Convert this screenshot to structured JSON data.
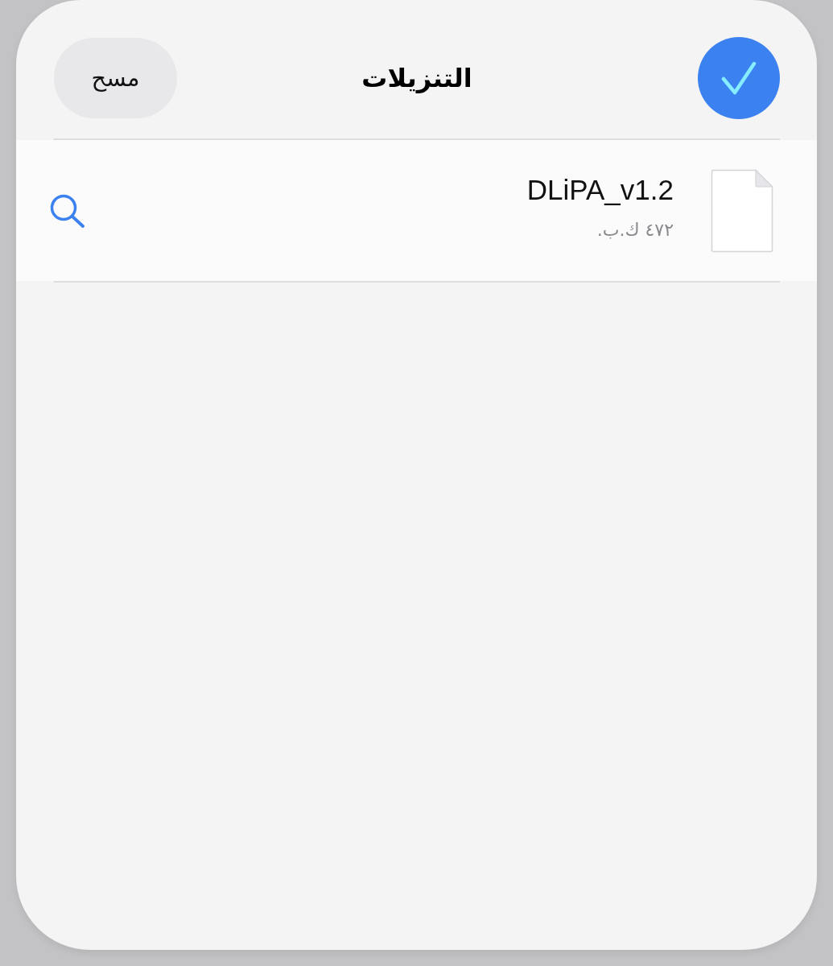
{
  "header": {
    "title": "التنزيلات",
    "clear_label": "مسح",
    "done_button": {
      "kind": "checkmark"
    }
  },
  "downloads": [
    {
      "name": "DLiPA_v1.2",
      "size": "٤٧٢ ك.ب."
    }
  ]
}
